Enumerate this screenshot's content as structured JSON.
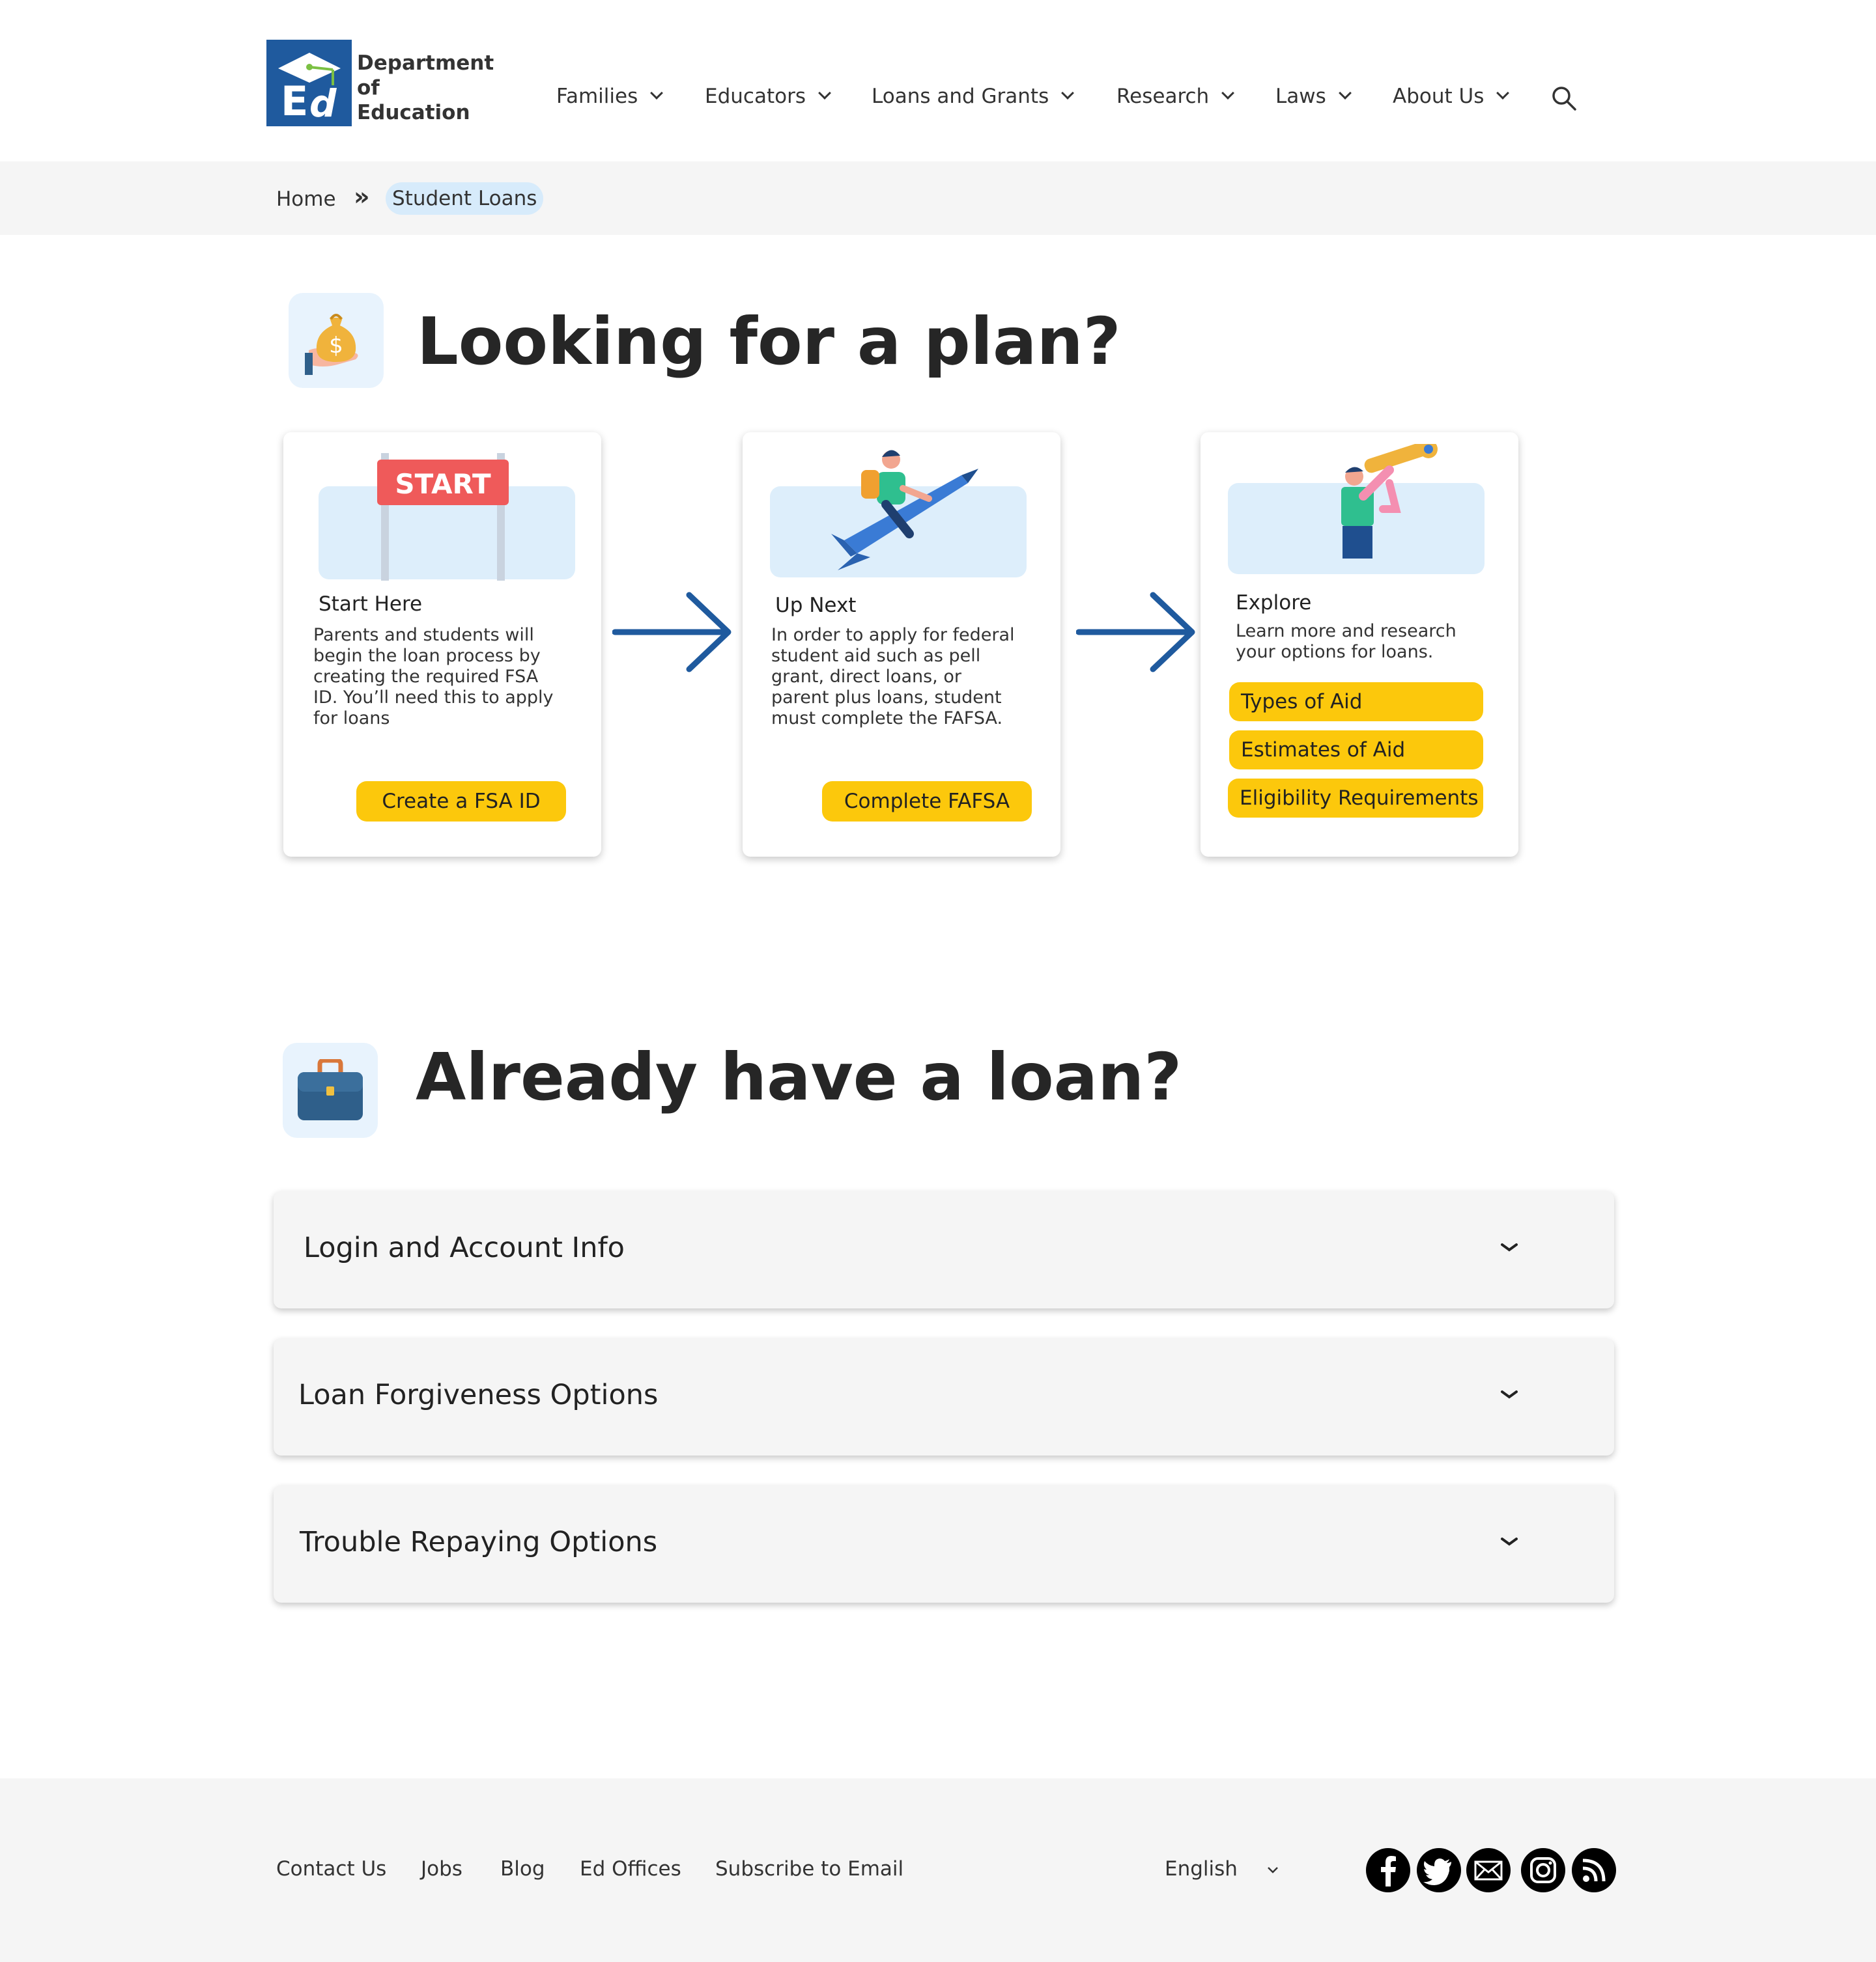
{
  "header": {
    "logo_text_1": "Department",
    "logo_text_2": "of",
    "logo_text_3": "Education",
    "nav": [
      {
        "label": "Families"
      },
      {
        "label": "Educators"
      },
      {
        "label": "Loans and Grants"
      },
      {
        "label": "Research"
      },
      {
        "label": "Laws"
      },
      {
        "label": "About Us"
      }
    ],
    "search_icon": "search-icon"
  },
  "breadcrumb": {
    "home": "Home",
    "separator": "»",
    "current": "Student Loans"
  },
  "plan_section": {
    "title": "Looking for a plan?",
    "icon": "money-bag-hand-icon",
    "cards": [
      {
        "illustration_text": "START",
        "title": "Start Here",
        "body_lines": [
          "Parents and students will",
          "begin the loan process by",
          "creating the required FSA",
          "ID. You’ll need this to apply",
          "for loans"
        ],
        "button": "Create a FSA ID"
      },
      {
        "title": "Up Next",
        "body_lines": [
          "In order to apply for federal",
          "student aid such as pell",
          "grant, direct loans, or",
          "parent plus loans, student",
          "must complete the FAFSA."
        ],
        "button": "Complete FAFSA"
      },
      {
        "title": "Explore",
        "body_lines": [
          "Learn more and research",
          "your options for loans."
        ],
        "buttons": [
          "Types of Aid",
          "Estimates of Aid",
          "Eligibility Requirements"
        ]
      }
    ]
  },
  "loan_section": {
    "title": "Already have a loan?",
    "icon": "briefcase-icon",
    "accordions": [
      {
        "label": "Login and Account Info"
      },
      {
        "label": "Loan Forgiveness Options"
      },
      {
        "label": "Trouble Repaying Options"
      }
    ]
  },
  "footer": {
    "links": [
      "Contact Us",
      "Jobs",
      "Blog",
      "Ed Offices",
      "Subscribe to Email"
    ],
    "language": "English",
    "social": [
      "facebook-icon",
      "twitter-icon",
      "email-icon",
      "instagram-icon",
      "rss-icon"
    ]
  },
  "colors": {
    "brand_blue": "#1f5a9e",
    "button_yellow": "#fcc80c",
    "light_blue": "#ddeefb",
    "footer_bg": "#f5f5f5"
  }
}
